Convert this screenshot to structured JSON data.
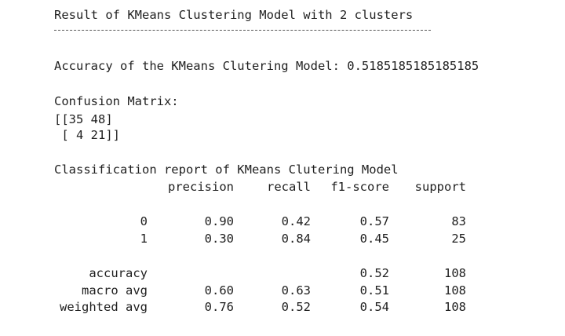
{
  "output": {
    "title": "Result of KMeans Clustering Model with 2 clusters",
    "accuracy_line": "Accuracy of the KMeans Clutering Model: 0.5185185185185185",
    "confusion_matrix_label": "Confusion Matrix:",
    "confusion_matrix_rows": [
      "[[35 48]",
      " [ 4 21]]"
    ],
    "report_title": "Classification report of KMeans Clutering Model"
  },
  "report": {
    "headers": [
      "precision",
      "recall",
      "f1-score",
      "support"
    ],
    "class_rows": [
      {
        "label": "0",
        "precision": "0.90",
        "recall": "0.42",
        "f1": "0.57",
        "support": "83"
      },
      {
        "label": "1",
        "precision": "0.30",
        "recall": "0.84",
        "f1": "0.45",
        "support": "25"
      }
    ],
    "summary_rows": [
      {
        "label": "accuracy",
        "precision": "",
        "recall": "",
        "f1": "0.52",
        "support": "108"
      },
      {
        "label": "macro avg",
        "precision": "0.60",
        "recall": "0.63",
        "f1": "0.51",
        "support": "108"
      },
      {
        "label": "weighted avg",
        "precision": "0.76",
        "recall": "0.52",
        "f1": "0.54",
        "support": "108"
      }
    ]
  }
}
